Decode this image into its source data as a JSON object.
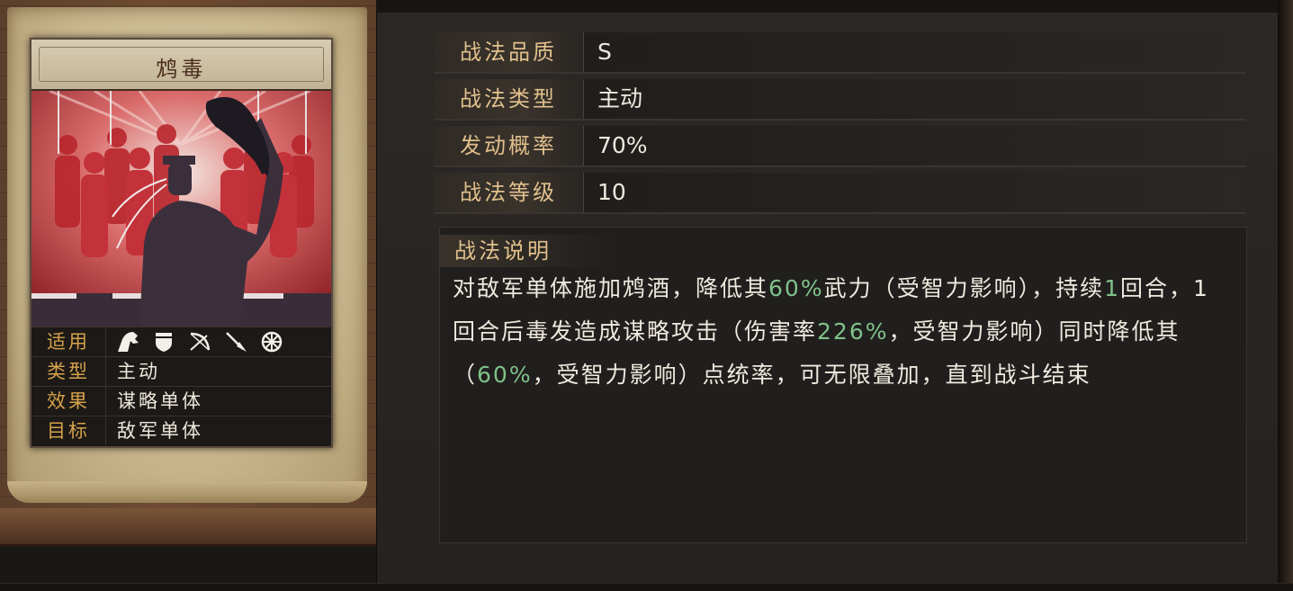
{
  "skill_card": {
    "name": "鸩毒",
    "props": [
      {
        "label": "适用",
        "icons": [
          "cavalry-icon",
          "shield-icon",
          "bow-icon",
          "spear-icon",
          "wheel-icon"
        ]
      },
      {
        "label": "类型",
        "value": "主动"
      },
      {
        "label": "效果",
        "value": "谋略单体"
      },
      {
        "label": "目标",
        "value": "敌军单体"
      }
    ]
  },
  "info": {
    "rows": [
      {
        "label": "战法品质",
        "value": "S"
      },
      {
        "label": "战法类型",
        "value": "主动"
      },
      {
        "label": "发动概率",
        "value": "70%"
      },
      {
        "label": "战法等级",
        "value": "10"
      }
    ],
    "description": {
      "label": "战法说明",
      "segments": [
        {
          "text": "对敌军单体施加鸩酒，降低其",
          "highlight": false
        },
        {
          "text": "60%",
          "highlight": true
        },
        {
          "text": "武力（受智力影响），持续",
          "highlight": false
        },
        {
          "text": "1",
          "highlight": true
        },
        {
          "text": "回合，1回合后毒发造成谋略攻击（伤害率",
          "highlight": false
        },
        {
          "text": "226%",
          "highlight": true
        },
        {
          "text": "，受智力影响）同时降低其（",
          "highlight": false
        },
        {
          "text": "60%",
          "highlight": true
        },
        {
          "text": "，受智力影响）点统率，可无限叠加，直到战斗结束",
          "highlight": false
        }
      ]
    }
  },
  "colors": {
    "label_gold": "#e0c08c",
    "highlight_green": "#7fc28a",
    "card_label_orange": "#d6a24a"
  }
}
